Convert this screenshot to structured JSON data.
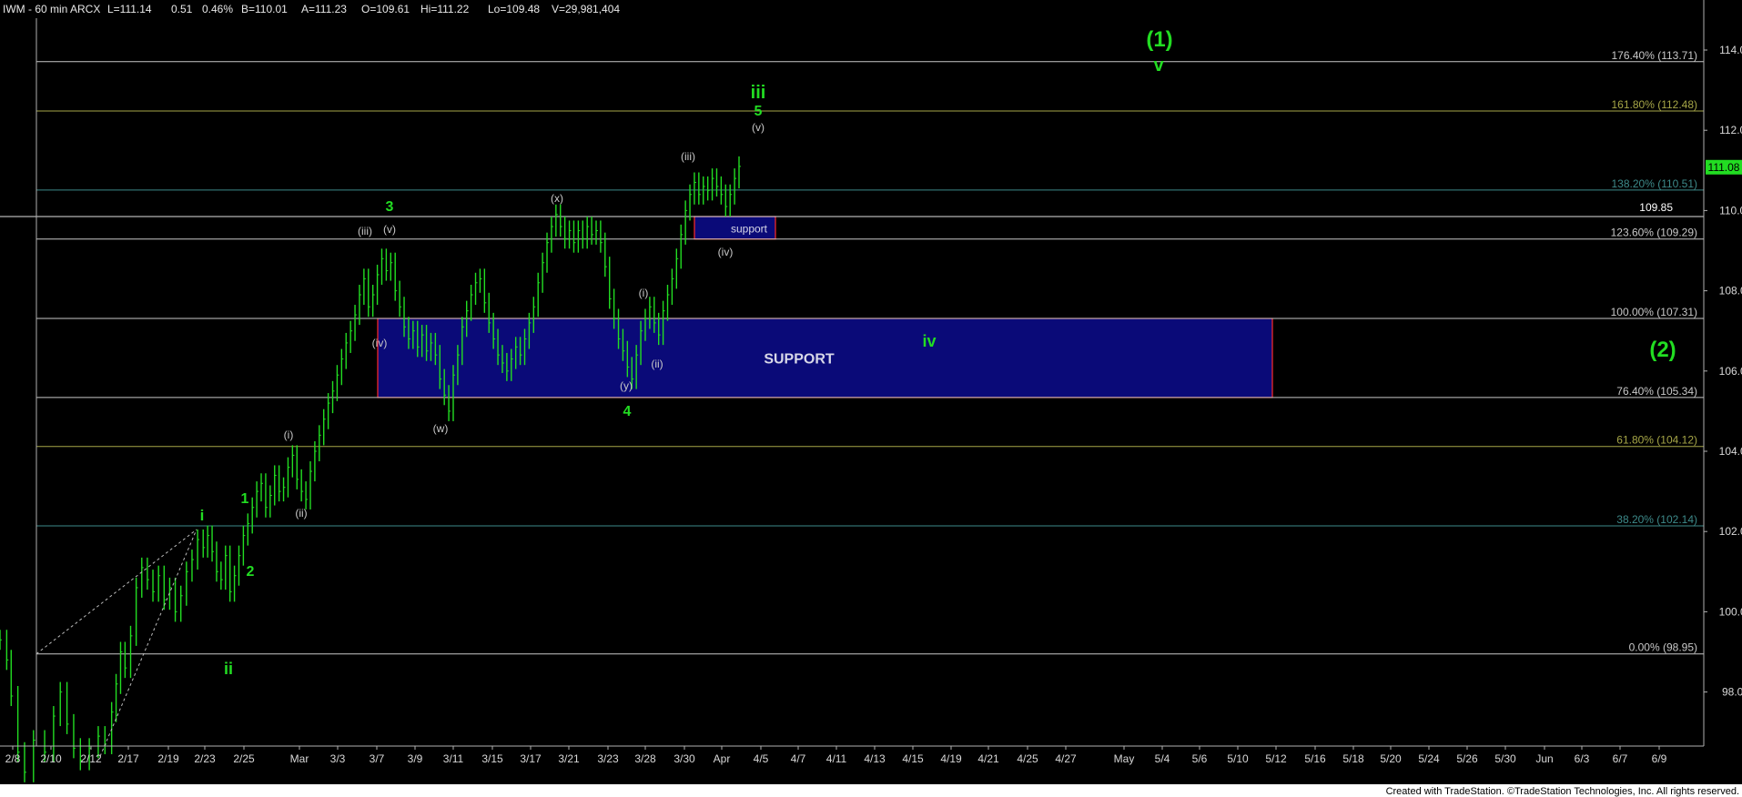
{
  "header": {
    "symbol_info": "IWM - 60 min  ARCX",
    "last": "L=111.14",
    "change": "0.51",
    "change_pct": "0.46%",
    "bid": "B=110.01",
    "ask": "A=111.23",
    "open": "O=109.61",
    "high": "Hi=111.22",
    "low": "Lo=109.48",
    "volume": "V=29,981,404"
  },
  "footer": {
    "text": "Created with TradeStation. ©TradeStation Technologies, Inc. All rights reserved."
  },
  "colors": {
    "background": "#000000",
    "fib_gray": "#c8c8c8",
    "fib_olive": "#a6a647",
    "fib_teal": "#3d8a8a",
    "wave_green": "#22dd22",
    "support_fill": "#0a0a78",
    "support_border": "#ff2a2a",
    "price_badge": "#22dd22"
  },
  "chart_data": {
    "type": "candlestick",
    "title": "",
    "xlabel": "",
    "ylabel": "",
    "ylim": [
      96.6,
      115.3
    ],
    "y_ticks": [
      "114.00",
      "112.00",
      "110.00",
      "108.00",
      "106.00",
      "104.00",
      "102.00",
      "100.00",
      "98.00"
    ],
    "x_ticks": [
      "2/8",
      "2/10",
      "2/12",
      "2/17",
      "2/19",
      "2/23",
      "2/25",
      "Mar",
      "3/3",
      "3/7",
      "3/9",
      "3/11",
      "3/15",
      "3/17",
      "3/21",
      "3/23",
      "3/28",
      "3/30",
      "Apr",
      "4/5",
      "4/7",
      "4/11",
      "4/13",
      "4/15",
      "4/19",
      "4/21",
      "4/25",
      "4/27",
      "May",
      "5/4",
      "5/6",
      "5/10",
      "5/12",
      "5/16",
      "5/18",
      "5/20",
      "5/24",
      "5/26",
      "5/30",
      "Jun",
      "6/3",
      "6/7",
      "6/9"
    ],
    "current_price": "111.08",
    "price_path": [
      [
        0,
        99.3
      ],
      [
        6,
        98.8
      ],
      [
        10,
        97.9
      ],
      [
        16,
        96.5
      ],
      [
        22,
        96.0
      ],
      [
        30,
        96.8
      ],
      [
        40,
        96.5
      ],
      [
        48,
        97.4
      ],
      [
        54,
        98.0
      ],
      [
        60,
        97.2
      ],
      [
        66,
        96.6
      ],
      [
        72,
        96.3
      ],
      [
        80,
        96.6
      ],
      [
        88,
        96.9
      ],
      [
        94,
        96.7
      ],
      [
        100,
        97.5
      ],
      [
        104,
        98.2
      ],
      [
        108,
        99.0
      ],
      [
        112,
        98.6
      ],
      [
        117,
        99.4
      ],
      [
        122,
        100.6
      ],
      [
        127,
        101.1
      ],
      [
        132,
        100.8
      ],
      [
        137,
        100.5
      ],
      [
        142,
        100.9
      ],
      [
        147,
        100.3
      ],
      [
        152,
        100.6
      ],
      [
        157,
        100.0
      ],
      [
        162,
        100.4
      ],
      [
        167,
        101.0
      ],
      [
        172,
        101.3
      ],
      [
        177,
        101.8
      ],
      [
        182,
        101.6
      ],
      [
        186,
        101.9
      ],
      [
        190,
        101.5
      ],
      [
        194,
        101.0
      ],
      [
        198,
        100.8
      ],
      [
        202,
        101.4
      ],
      [
        206,
        100.5
      ],
      [
        210,
        100.9
      ],
      [
        214,
        101.4
      ],
      [
        218,
        101.9
      ],
      [
        222,
        102.2
      ],
      [
        226,
        102.6
      ],
      [
        230,
        103.0
      ],
      [
        234,
        103.2
      ],
      [
        238,
        102.6
      ],
      [
        242,
        102.9
      ],
      [
        246,
        103.4
      ],
      [
        250,
        103.0
      ],
      [
        254,
        103.1
      ],
      [
        258,
        103.6
      ],
      [
        262,
        103.9
      ],
      [
        266,
        103.3
      ],
      [
        270,
        103.0
      ],
      [
        274,
        102.8
      ],
      [
        278,
        103.5
      ],
      [
        282,
        104.0
      ],
      [
        286,
        104.4
      ],
      [
        290,
        104.8
      ],
      [
        294,
        105.2
      ],
      [
        298,
        105.5
      ],
      [
        302,
        105.9
      ],
      [
        306,
        106.3
      ],
      [
        310,
        106.7
      ],
      [
        314,
        107.0
      ],
      [
        318,
        107.4
      ],
      [
        322,
        107.9
      ],
      [
        326,
        108.3
      ],
      [
        330,
        107.6
      ],
      [
        334,
        107.9
      ],
      [
        338,
        108.4
      ],
      [
        342,
        108.8
      ],
      [
        346,
        108.5
      ],
      [
        350,
        108.7
      ],
      [
        354,
        108.0
      ],
      [
        358,
        107.6
      ],
      [
        362,
        107.1
      ],
      [
        366,
        106.8
      ],
      [
        370,
        107.0
      ],
      [
        374,
        106.6
      ],
      [
        378,
        106.9
      ],
      [
        382,
        106.5
      ],
      [
        386,
        106.7
      ],
      [
        390,
        106.4
      ],
      [
        394,
        105.8
      ],
      [
        398,
        105.4
      ],
      [
        402,
        105.0
      ],
      [
        406,
        105.9
      ],
      [
        410,
        106.4
      ],
      [
        414,
        107.1
      ],
      [
        418,
        107.5
      ],
      [
        422,
        107.9
      ],
      [
        426,
        108.2
      ],
      [
        430,
        108.3
      ],
      [
        434,
        107.7
      ],
      [
        438,
        107.2
      ],
      [
        442,
        106.8
      ],
      [
        446,
        106.4
      ],
      [
        450,
        106.2
      ],
      [
        454,
        106.0
      ],
      [
        458,
        106.3
      ],
      [
        462,
        106.6
      ],
      [
        466,
        106.4
      ],
      [
        470,
        106.8
      ],
      [
        474,
        107.2
      ],
      [
        478,
        107.6
      ],
      [
        482,
        108.2
      ],
      [
        486,
        108.7
      ],
      [
        490,
        109.2
      ],
      [
        494,
        109.6
      ],
      [
        498,
        109.9
      ],
      [
        502,
        109.6
      ],
      [
        506,
        109.3
      ],
      [
        510,
        109.5
      ],
      [
        514,
        109.2
      ],
      [
        518,
        109.5
      ],
      [
        522,
        109.3
      ],
      [
        526,
        109.6
      ],
      [
        530,
        109.4
      ],
      [
        534,
        109.5
      ],
      [
        538,
        109.2
      ],
      [
        542,
        108.6
      ],
      [
        546,
        107.8
      ],
      [
        550,
        107.3
      ],
      [
        554,
        106.8
      ],
      [
        558,
        106.5
      ],
      [
        562,
        106.1
      ],
      [
        566,
        105.8
      ],
      [
        570,
        106.4
      ],
      [
        574,
        107.0
      ],
      [
        578,
        107.3
      ],
      [
        582,
        107.6
      ],
      [
        586,
        107.2
      ],
      [
        590,
        106.9
      ],
      [
        594,
        107.5
      ],
      [
        598,
        107.9
      ],
      [
        602,
        108.3
      ],
      [
        606,
        108.8
      ],
      [
        610,
        109.4
      ],
      [
        614,
        110.0
      ],
      [
        618,
        110.4
      ],
      [
        622,
        110.7
      ],
      [
        626,
        110.4
      ],
      [
        630,
        110.6
      ],
      [
        634,
        110.5
      ],
      [
        638,
        110.8
      ],
      [
        642,
        110.6
      ],
      [
        646,
        110.4
      ],
      [
        650,
        110.1
      ],
      [
        654,
        110.4
      ],
      [
        658,
        110.8
      ],
      [
        662,
        111.1
      ]
    ],
    "fib_levels": [
      {
        "label": "176.40% (113.71)",
        "value": 113.71,
        "color": "#c8c8c8"
      },
      {
        "label": "161.80% (112.48)",
        "value": 112.48,
        "color": "#a6a647"
      },
      {
        "label": "138.20% (110.51)",
        "value": 110.51,
        "color": "#3d8a8a"
      },
      {
        "label": "123.60% (109.29)",
        "value": 109.29,
        "color": "#c8c8c8"
      },
      {
        "label": "100.00% (107.31)",
        "value": 107.31,
        "color": "#c8c8c8"
      },
      {
        "label": "76.40% (105.34)",
        "value": 105.34,
        "color": "#c8c8c8"
      },
      {
        "label": "61.80% (104.12)",
        "value": 104.12,
        "color": "#a6a647"
      },
      {
        "label": "38.20% (102.14)",
        "value": 102.14,
        "color": "#3d8a8a"
      },
      {
        "label": "0.00% (98.95)",
        "value": 98.95,
        "color": "#c8c8c8"
      }
    ],
    "horizontal_line": {
      "label": "109.85",
      "value": 109.85
    },
    "support_zones": [
      {
        "label": "SUPPORT",
        "from_value": 107.31,
        "to_value": 105.34
      },
      {
        "label": "support",
        "from_value": 109.85,
        "to_value": 109.29
      }
    ],
    "gray_wave_labels": [
      "(i)",
      "(ii)",
      "(iii)",
      "(iv)",
      "(v)",
      "(w)",
      "(x)",
      "(y)",
      "(i)",
      "(ii)",
      "(iii)",
      "(iv)",
      "(v)"
    ],
    "green_wave_labels": [
      "i",
      "ii",
      "1",
      "2",
      "3",
      "4",
      "5",
      "iii",
      "iv",
      "v",
      "(1)",
      "(2)"
    ]
  }
}
